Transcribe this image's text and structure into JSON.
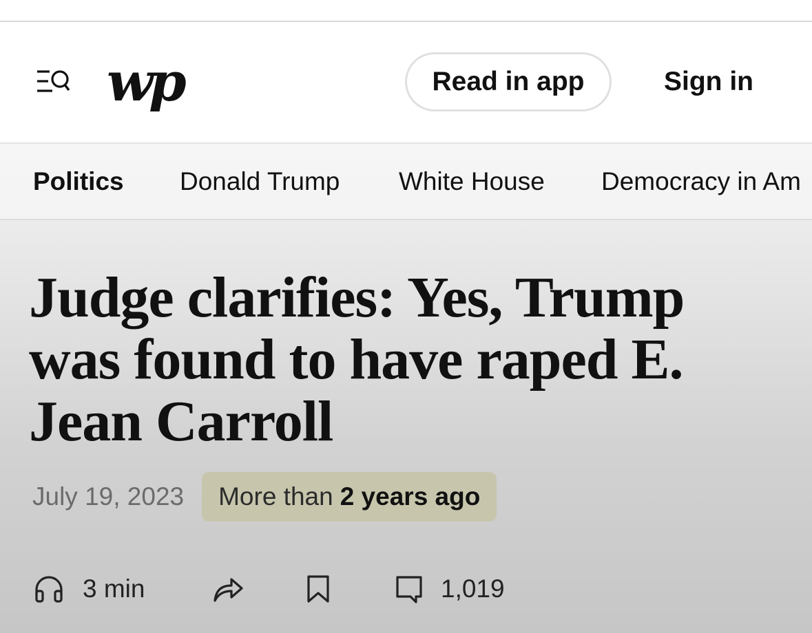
{
  "header": {
    "logo_text": "wp",
    "read_in_app_label": "Read in app",
    "sign_in_label": "Sign in"
  },
  "nav": {
    "items": [
      {
        "label": "Politics",
        "active": true
      },
      {
        "label": "Donald Trump",
        "active": false
      },
      {
        "label": "White House",
        "active": false
      },
      {
        "label": "Democracy in Am",
        "active": false
      }
    ]
  },
  "article": {
    "headline_lines": [
      "Judge clarifies: Yes, Trump",
      "was found to have raped E.",
      "Jean Carroll"
    ],
    "date": "July 19, 2023",
    "age_prefix": "More than",
    "age_strong": "2 years ago",
    "listen_duration": "3 min",
    "comment_count": "1,019"
  },
  "icons": {
    "menu": "menu-search-icon",
    "listen": "headphones-icon",
    "share": "share-arrow-icon",
    "save": "bookmark-icon",
    "comments": "comment-icon"
  },
  "colors": {
    "badge_background": "#c7c6ad",
    "date_text": "#6b6b6b"
  }
}
